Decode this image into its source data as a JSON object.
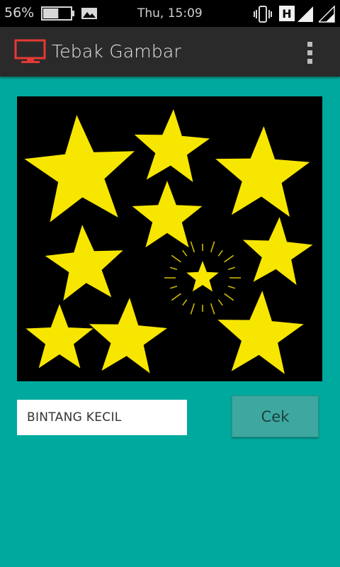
{
  "status_bar": {
    "battery_percent": "56%",
    "clock": "Thu, 15:09",
    "network_type": "H",
    "battery_level": 0.56
  },
  "action_bar": {
    "title": "Tebak Gambar",
    "app_icon": "monitor-icon",
    "menu_icon": "overflow-menu-icon"
  },
  "puzzle": {
    "image_description_icon": "stars-image"
  },
  "answer": {
    "value": "BINTANG KECIL"
  },
  "check_button": {
    "label": "Cek"
  },
  "colors": {
    "background": "#00a99d",
    "star": "#f7e600",
    "app_icon": "#e53935",
    "button": "#3ea8a0"
  }
}
